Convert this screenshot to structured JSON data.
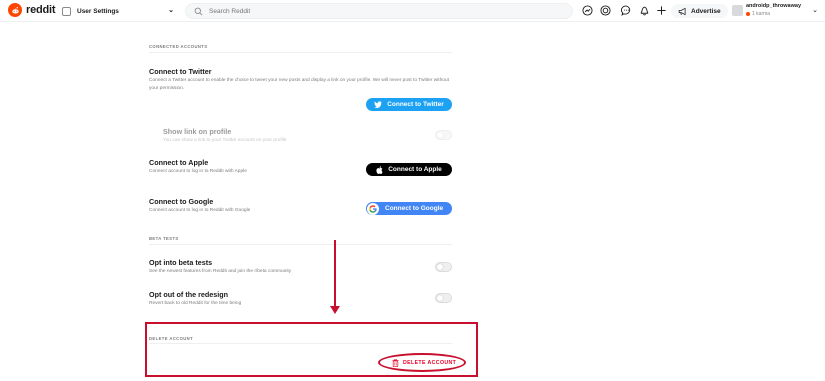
{
  "header": {
    "logo_text": "reddit",
    "dropdown_label": "User Settings",
    "search_placeholder": "Search Reddit",
    "advertise_label": "Advertise",
    "username": "androidp_throwaway",
    "karma": "1 karma",
    "icons": [
      "popular-icon",
      "coins-icon",
      "chat-icon",
      "bell-icon",
      "plus-icon",
      "megaphone-icon"
    ]
  },
  "connected_accounts": {
    "section_title": "CONNECTED ACCOUNTS",
    "twitter": {
      "title": "Connect to Twitter",
      "desc": "Connect a Twitter account to enable the choice to tweet your new posts and display a link on your profile. We will never post to Twitter without your permission.",
      "button": "Connect to Twitter",
      "color": "#1da1f2"
    },
    "show_link": {
      "title": "Show link on profile",
      "desc": "You can show a link to your Twitter account on your profile"
    },
    "apple": {
      "title": "Connect to Apple",
      "desc": "Connect account to log in to Reddit with Apple",
      "button": "Connect to Apple",
      "color": "#000000"
    },
    "google": {
      "title": "Connect to Google",
      "desc": "Connect account to log in to Reddit with Google",
      "button": "Connect to Google",
      "color": "#4285f4"
    }
  },
  "beta_tests": {
    "section_title": "BETA TESTS",
    "opt_in": {
      "title": "Opt into beta tests",
      "desc": "See the newest features from Reddit and join the r/beta community"
    },
    "opt_out": {
      "title": "Opt out of the redesign",
      "desc": "Revert back to old Reddit for the time being"
    }
  },
  "delete_account": {
    "section_title": "DELETE ACCOUNT",
    "button": "DELETE ACCOUNT",
    "color": "#ea0027"
  },
  "annotation_color": "#c8102e"
}
